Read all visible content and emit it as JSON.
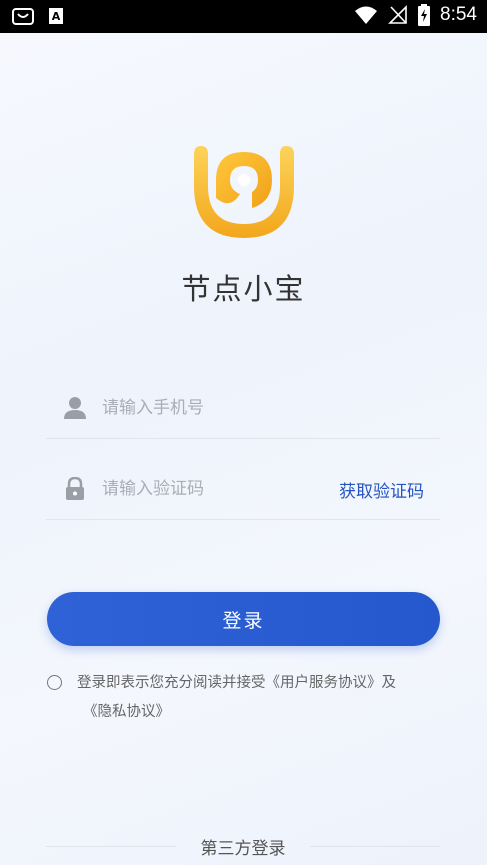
{
  "status_bar": {
    "time": "8:54"
  },
  "app": {
    "name": "节点小宝"
  },
  "phone": {
    "placeholder": "请输入手机号"
  },
  "code": {
    "placeholder": "请输入验证码",
    "get_code_label": "获取验证码"
  },
  "login_button": {
    "label": "登录"
  },
  "agreement": {
    "line1": "登录即表示您充分阅读并接受《用户服务协议》及",
    "line2": "《隐私协议》"
  },
  "third_party": {
    "label": "第三方登录"
  },
  "colors": {
    "accent": "#2557cd",
    "logo_yellow": "#f6b923"
  }
}
